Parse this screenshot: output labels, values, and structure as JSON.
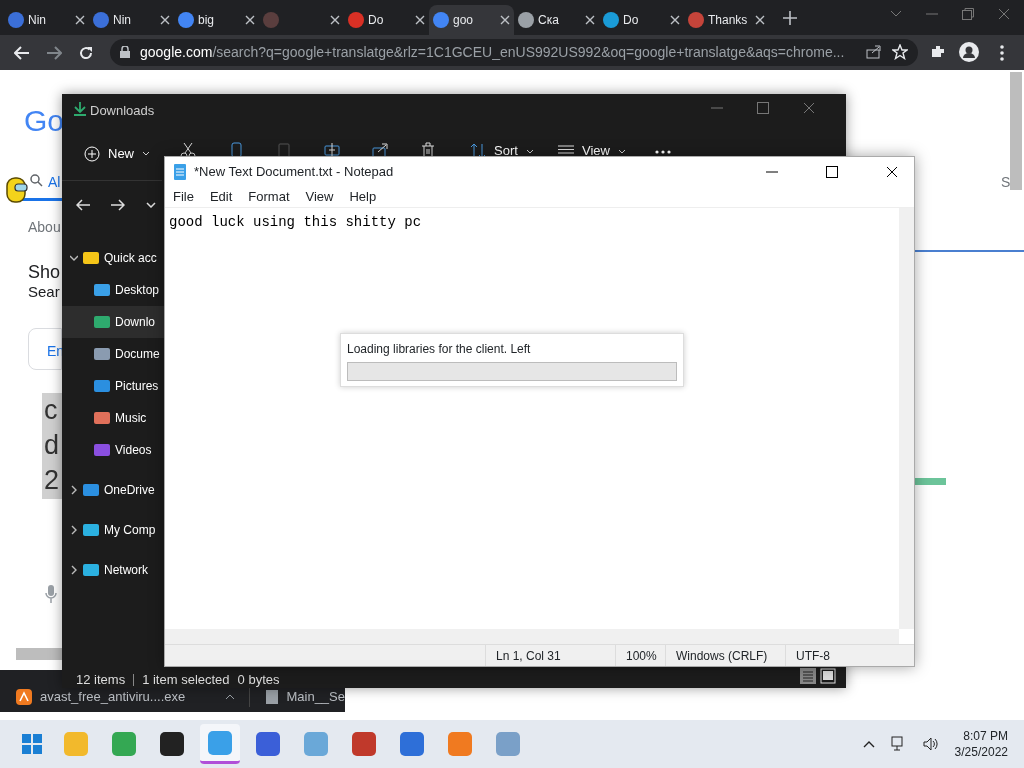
{
  "browser": {
    "tabs": [
      {
        "label": "Nin",
        "color": "#3b6fd8",
        "selected": false
      },
      {
        "label": "Nin",
        "color": "#3b6fd8",
        "selected": false
      },
      {
        "label": "big",
        "color": "#4285f4",
        "selected": false
      },
      {
        "color": "#5a3e3e",
        "selected": false
      },
      {
        "label": "Do",
        "color": "#d93025",
        "selected": false
      },
      {
        "label": "goo",
        "color": "#4285f4",
        "selected": true
      },
      {
        "label": "Ска",
        "color": "#9aa0a6",
        "selected": false
      },
      {
        "label": "Do",
        "color": "#1a9bd7",
        "selected": false
      },
      {
        "label": "Thanks",
        "color": "#c5443a",
        "selected": false
      }
    ],
    "url": {
      "domain": "google.com",
      "path": "/search?q=google+translatge&rlz=1C1GCEU_enUS992US992&oq=google+translatge&aqs=chrome..."
    }
  },
  "page": {
    "logo": "Go",
    "search_tab": "Al",
    "about": "Abou",
    "heading": "Sho",
    "subheading": "Sear",
    "card": "En",
    "highlight": [
      "c",
      "d",
      "2"
    ],
    "side_letter": "S"
  },
  "explorer": {
    "title": "Downloads",
    "toolbar": {
      "new": "New",
      "sort": "Sort",
      "view": "View"
    },
    "nav": [
      {
        "label": "Quick acc",
        "color": "#f5c518",
        "expanded": true,
        "selected": false,
        "children": [
          {
            "label": "Desktop",
            "color": "#3aa0e8",
            "selected": false
          },
          {
            "label": "Downlo",
            "color": "#2eaa6e",
            "selected": true
          },
          {
            "label": "Docume",
            "color": "#8a9bb0",
            "selected": false
          },
          {
            "label": "Pictures",
            "color": "#2b8fe0",
            "selected": false
          },
          {
            "label": "Music",
            "color": "#e0705a",
            "selected": false
          },
          {
            "label": "Videos",
            "color": "#8a4fe0",
            "selected": false
          }
        ]
      },
      {
        "label": "OneDrive",
        "color": "#2b8fe0",
        "expanded": false,
        "selected": false
      },
      {
        "label": "My Comp",
        "color": "#2bb0e0",
        "expanded": false,
        "selected": false
      },
      {
        "label": "Network",
        "color": "#2bb0e0",
        "expanded": false,
        "selected": false
      }
    ],
    "status": [
      "12 items",
      "1 item selected",
      "0 bytes"
    ]
  },
  "notepad": {
    "title": "*New Text Document.txt - Notepad",
    "menu": [
      "File",
      "Edit",
      "Format",
      "View",
      "Help"
    ],
    "text": "good luck using this shitty pc",
    "status": [
      "Ln 1, Col 31",
      "100%",
      "Windows (CRLF)",
      "UTF-8"
    ]
  },
  "dialog": {
    "message": "Loading libraries for the client. Left",
    "level": 0
  },
  "downloads": [
    "avast_free_antiviru....exe",
    "Main__Se"
  ],
  "taskbar": {
    "apps": [
      {
        "color": "#f2b92c",
        "selected": false
      },
      {
        "color": "#34a853",
        "selected": false
      },
      {
        "color": "#222222",
        "selected": false
      },
      {
        "color": "#3aa0e8",
        "selected": true
      },
      {
        "color": "#3b5fd8",
        "selected": false
      },
      {
        "color": "#6aa8d8",
        "selected": false
      },
      {
        "color": "#c0392b",
        "selected": false
      },
      {
        "color": "#2e6fd8",
        "selected": false
      },
      {
        "color": "#f07a20",
        "selected": false
      },
      {
        "color": "#7aa0c8",
        "selected": false
      }
    ],
    "time": "8:07 PM",
    "date": "3/25/2022"
  }
}
